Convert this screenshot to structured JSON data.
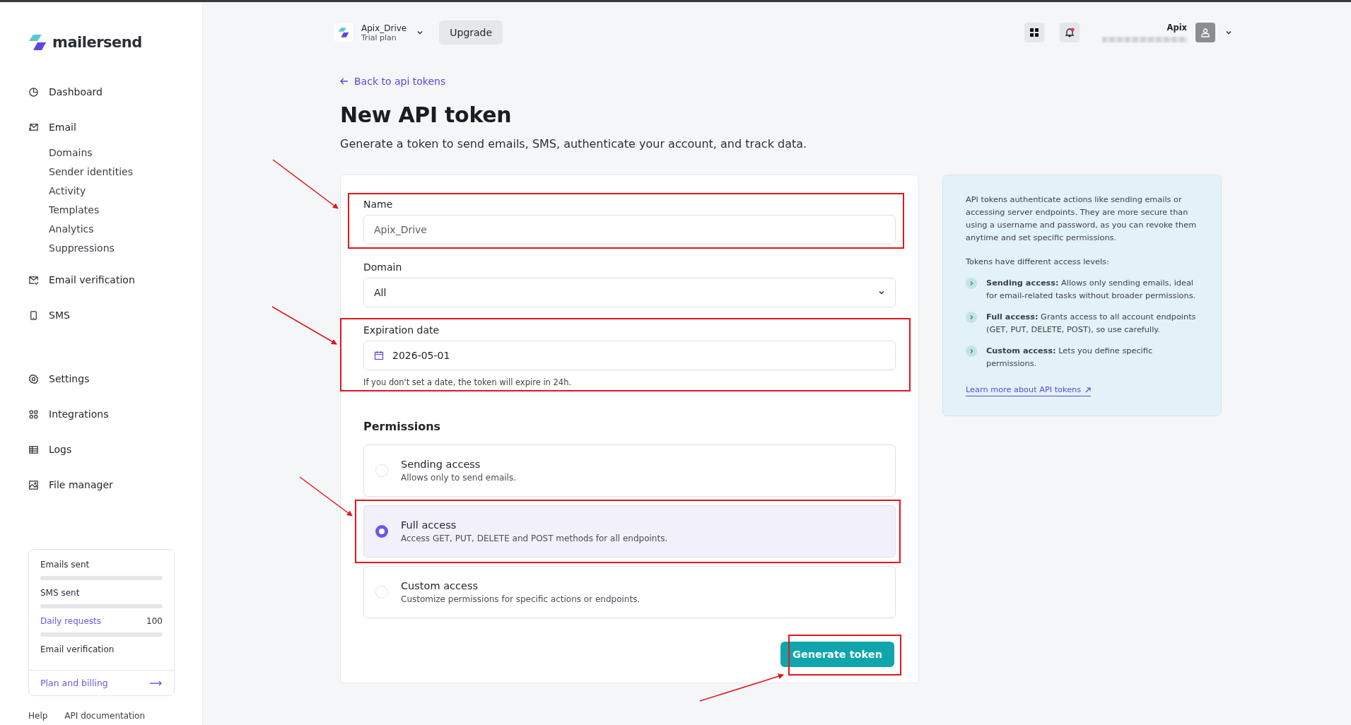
{
  "brand": {
    "name": "mailersend"
  },
  "sidebar": {
    "items": [
      {
        "label": "Dashboard"
      },
      {
        "label": "Email",
        "children": [
          {
            "label": "Domains"
          },
          {
            "label": "Sender identities"
          },
          {
            "label": "Activity"
          },
          {
            "label": "Templates"
          },
          {
            "label": "Analytics"
          },
          {
            "label": "Suppressions"
          }
        ]
      },
      {
        "label": "Email verification"
      },
      {
        "label": "SMS"
      },
      {
        "label": "Settings"
      },
      {
        "label": "Integrations"
      },
      {
        "label": "Logs"
      },
      {
        "label": "File manager"
      }
    ],
    "usage": [
      {
        "label": "Emails sent",
        "highlight": false,
        "kind": "meter"
      },
      {
        "label": "SMS sent",
        "highlight": false,
        "kind": "meter"
      },
      {
        "label": "Daily requests",
        "highlight": true,
        "count": "100",
        "kind": "meter"
      },
      {
        "label": "Email verification",
        "highlight": false,
        "kind": "plain"
      }
    ],
    "billing_link": "Plan and billing",
    "footer_links": [
      "Help",
      "API documentation"
    ]
  },
  "topbar": {
    "org": "Apix_Drive",
    "plan": "Trial plan",
    "upgrade": "Upgrade",
    "user": "Apix",
    "notification": true
  },
  "back_link": "Back to api tokens",
  "title": "New API token",
  "subtitle": "Generate a token to send emails, SMS, authenticate your account, and track data.",
  "form": {
    "name": {
      "label": "Name",
      "value": "Apix_Drive"
    },
    "domain": {
      "label": "Domain",
      "value": "All"
    },
    "expiration": {
      "label": "Expiration date",
      "value": "2026-05-01",
      "hint": "If you don't set a date, the token will expire in 24h."
    },
    "permissions_title": "Permissions",
    "permissions": [
      {
        "title": "Sending access",
        "description": "Allows only to send emails.",
        "selected": false
      },
      {
        "title": "Full access",
        "description": "Access GET, PUT, DELETE and POST methods for all endpoints.",
        "selected": true
      },
      {
        "title": "Custom access",
        "description": "Customize permissions for specific actions or endpoints.",
        "selected": false
      }
    ],
    "submit": "Generate token"
  },
  "info": {
    "intro": "API tokens authenticate actions like sending emails or accessing server endpoints. They are more secure than using a username and password, as you can revoke them anytime and set specific permissions.",
    "levels_title": "Tokens have different access levels:",
    "levels": [
      "**Sending access:** Allows only sending emails, ideal for email-related tasks without broader permissions.",
      "**Full access:** Grants access to all account endpoints (GET, PUT, DELETE, POST), so use carefully.",
      "**Custom access:** Lets you define specific permissions."
    ],
    "link": "Learn more about API tokens"
  },
  "annotations": [
    {
      "kind": "frame"
    },
    {
      "kind": "frame"
    },
    {
      "kind": "frame"
    },
    {
      "kind": "frame"
    },
    {
      "kind": "arrow"
    },
    {
      "kind": "arrow"
    },
    {
      "kind": "arrow"
    },
    {
      "kind": "arrow"
    }
  ]
}
